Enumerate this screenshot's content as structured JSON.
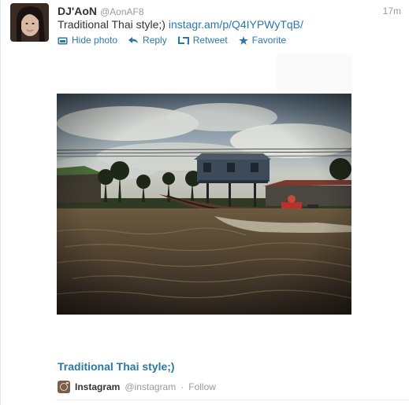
{
  "tweet": {
    "fullname": "DJ'AoN",
    "username": "@AonAF8",
    "timestamp": "17m",
    "text": "Traditional Thai style;)",
    "link": "instagr.am/p/Q4IYPWyTqB/"
  },
  "actions": {
    "hide_photo": "Hide photo",
    "reply": "Reply",
    "retweet": "Retweet",
    "favorite": "Favorite"
  },
  "card": {
    "title": "Traditional Thai style;)"
  },
  "source": {
    "name": "Instagram",
    "handle": "@instagram",
    "separator": "·",
    "follow": "Follow"
  },
  "icons": [
    "photo-icon",
    "reply-icon",
    "retweet-icon",
    "star-icon",
    "instagram-icon"
  ],
  "colors": {
    "link": "#2a78a7",
    "text": "#333333",
    "muted": "#999999"
  }
}
